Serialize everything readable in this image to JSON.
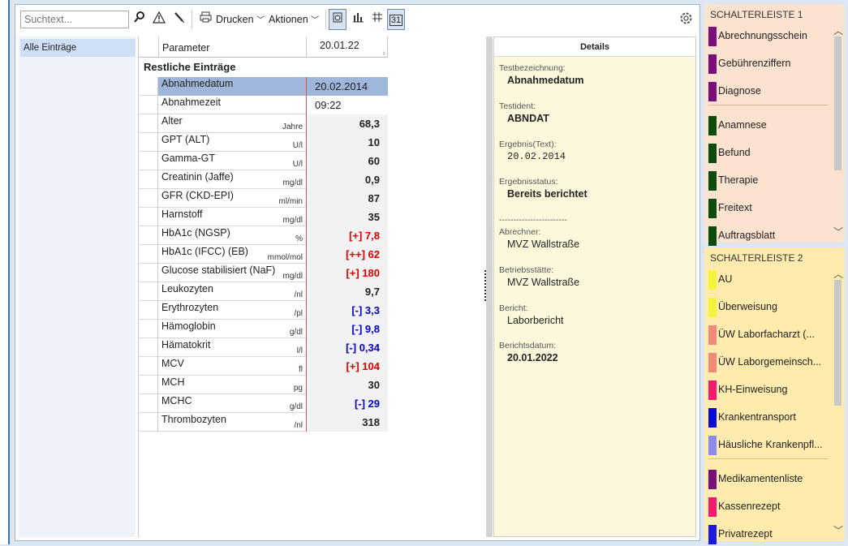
{
  "toolbar": {
    "search_placeholder": "Suchtext...",
    "print_label": "Drucken",
    "actions_label": "Aktionen",
    "chart_icon": "bar-chart-icon",
    "calendar_label": "31"
  },
  "sidebar": {
    "items": [
      {
        "label": "Alle Einträge"
      }
    ]
  },
  "table": {
    "header_param": "Parameter",
    "header_date": "20.01.22",
    "section": "Restliche Einträge",
    "rows": [
      {
        "name": "Abnahmedatum",
        "unit": "",
        "value": "20.02.2014",
        "flag": "plain"
      },
      {
        "name": "Abnahmezeit",
        "unit": "",
        "value": "09:22",
        "flag": "plain"
      },
      {
        "name": "Alter",
        "unit": "Jahre",
        "value": "68,3",
        "flag": "normal"
      },
      {
        "name": "GPT (ALT)",
        "unit": "U/l",
        "value": "10",
        "flag": "normal"
      },
      {
        "name": "Gamma-GT",
        "unit": "U/l",
        "value": "60",
        "flag": "normal"
      },
      {
        "name": "Creatinin (Jaffe)",
        "unit": "mg/dl",
        "value": "0,9",
        "flag": "normal"
      },
      {
        "name": "GFR (CKD-EPI)",
        "unit": "ml/min",
        "value": "87",
        "flag": "normal"
      },
      {
        "name": "Harnstoff",
        "unit": "mg/dl",
        "value": "35",
        "flag": "normal"
      },
      {
        "name": "HbA1c (NGSP)",
        "unit": "%",
        "value": "[+] 7,8",
        "flag": "hi"
      },
      {
        "name": "HbA1c (IFCC) (EB)",
        "unit": "mmol/mol",
        "value": "[++] 62",
        "flag": "hi"
      },
      {
        "name": "Glucose stabilisiert (NaF)",
        "unit": "mg/dl",
        "value": "[+] 180",
        "flag": "hi"
      },
      {
        "name": "Leukozyten",
        "unit": "/nl",
        "value": "9,7",
        "flag": "normal"
      },
      {
        "name": "Erythrozyten",
        "unit": "/pl",
        "value": "[-] 3,3",
        "flag": "lo"
      },
      {
        "name": "Hämoglobin",
        "unit": "g/dl",
        "value": "[-] 9,8",
        "flag": "lo"
      },
      {
        "name": "Hämatokrit",
        "unit": "l/l",
        "value": "[-] 0,34",
        "flag": "lo"
      },
      {
        "name": "MCV",
        "unit": "fl",
        "value": "[+] 104",
        "flag": "hi"
      },
      {
        "name": "MCH",
        "unit": "pg",
        "value": "30",
        "flag": "normal"
      },
      {
        "name": "MCHC",
        "unit": "g/dl",
        "value": "[-] 29",
        "flag": "lo"
      },
      {
        "name": "Thrombozyten",
        "unit": "/nl",
        "value": "318",
        "flag": "normal"
      }
    ]
  },
  "details": {
    "title": "Details",
    "test_label": "Testbezeichnung:",
    "test_value": "Abnahmedatum",
    "id_label": "Testident:",
    "id_value": "ABNDAT",
    "result_label": "Ergebnis(Text):",
    "result_value": "20.02.2014",
    "status_label": "Ergebnisstatus:",
    "status_value": "Bereits berichtet",
    "separator": "------------------------",
    "billing_label": "Abrechner:",
    "billing_value": "MVZ Wallstraße",
    "site_label": "Betriebsstätte:",
    "site_value": "MVZ Wallstraße",
    "report_label": "Bericht:",
    "report_value": "Laborbericht",
    "report_date_label": "Berichtsdatum:",
    "report_date_value": "20.01.2022"
  },
  "panel1": {
    "title": "SCHALTERLEISTE 1",
    "items": [
      {
        "label": "Abrechnungsschein",
        "color": "#7a0f7a"
      },
      {
        "label": "Gebührenziffern",
        "color": "#7a0f7a"
      },
      {
        "label": "Diagnose",
        "color": "#7a0f7a"
      },
      {
        "label": "Anamnese",
        "color": "#0d4a0d"
      },
      {
        "label": "Befund",
        "color": "#0d4a0d"
      },
      {
        "label": "Therapie",
        "color": "#0d4a0d"
      },
      {
        "label": "Freitext",
        "color": "#0d4a0d"
      },
      {
        "label": "Auftragsblatt",
        "color": "#0d4a0d"
      }
    ]
  },
  "panel2": {
    "title": "SCHALTERLEISTE 2",
    "items": [
      {
        "label": "AU",
        "color": "#f4f43a"
      },
      {
        "label": "Überweisung",
        "color": "#f4f43a"
      },
      {
        "label": "ÜW  Laborfacharzt (...",
        "color": "#f28a7c"
      },
      {
        "label": "ÜW Laborgemeinsch...",
        "color": "#f28a7c"
      },
      {
        "label": "KH-Einweisung",
        "color": "#f01a73"
      },
      {
        "label": "Krankentransport",
        "color": "#0a0ad6"
      },
      {
        "label": "Häusliche Krankenpfl...",
        "color": "#8a8af0"
      },
      {
        "label": "Medikamentenliste",
        "color": "#7a0f7a"
      },
      {
        "label": "Kassenrezept",
        "color": "#f01a73"
      },
      {
        "label": "Privatrezept",
        "color": "#1a1ae0"
      }
    ]
  }
}
